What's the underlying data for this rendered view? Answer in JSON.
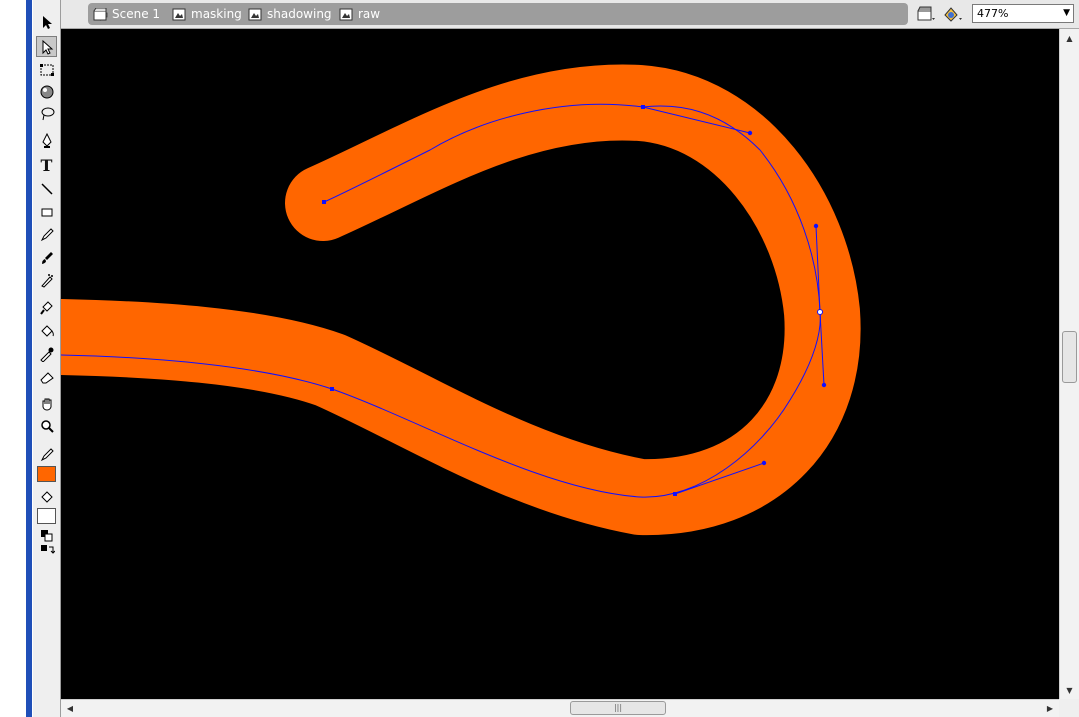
{
  "breadcrumb": {
    "scene": "Scene 1",
    "symbols": [
      "masking",
      "shadowing",
      "raw"
    ]
  },
  "zoom": {
    "value": "477%"
  },
  "colors": {
    "stroke_color": "#ff6600",
    "fill_color": "#ffffff",
    "stage_background": "#000000",
    "path_outline": "#1010ff"
  },
  "tools": [
    "arrow-tool-icon",
    "subselect-tool-icon",
    "free-transform-tool-icon",
    "fill-transform-tool-icon",
    "lasso-tool-icon",
    "pen-tool-icon",
    "text-tool-icon",
    "line-tool-icon",
    "rectangle-tool-icon",
    "pencil-tool-icon",
    "brush-tool-icon",
    "spray-tool-icon",
    "ink-bottle-tool-icon",
    "paint-bucket-tool-icon",
    "eyedropper-tool-icon",
    "eraser-tool-icon",
    "hand-tool-icon",
    "zoom-tool-icon"
  ]
}
